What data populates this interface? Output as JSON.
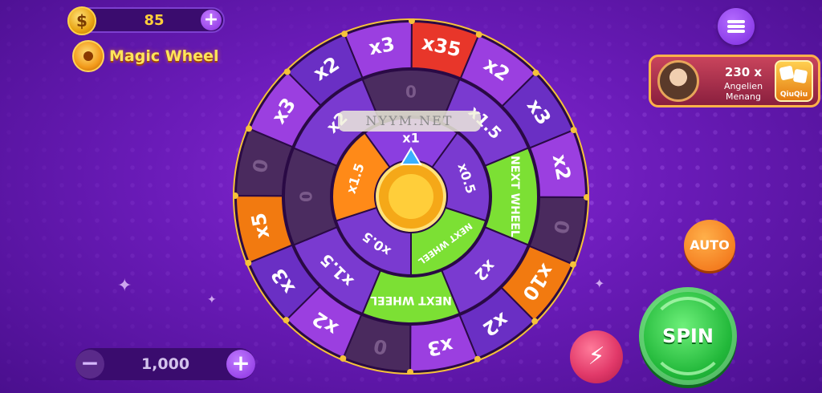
{
  "balance": {
    "amount": "85",
    "coin_symbol": "$",
    "add_label": "+"
  },
  "game": {
    "title": "Magic Wheel"
  },
  "menu": {
    "icon": "hamburger-menu-icon"
  },
  "winner": {
    "multiplier": "230 x",
    "name": "Angelien",
    "action": "Menang",
    "app_logo_text": "QiuQiu"
  },
  "watermark": {
    "plate": "NYYM.NET"
  },
  "wheel": {
    "outer": [
      "x3",
      "x35",
      "x2",
      "x3",
      "x2",
      "0",
      "x10",
      "x2",
      "x3",
      "0",
      "x2",
      "x3",
      "x5",
      "0",
      "x3",
      "x2"
    ],
    "middle": [
      "0",
      "x1.5",
      "NEXT WHEEL",
      "x2",
      "NEXT WHEEL",
      "x1.5",
      "0",
      "x2"
    ],
    "inner": [
      "x1",
      "x0.5",
      "NEXT WHEEL",
      "x0.5",
      "x1.5"
    ],
    "colors": {
      "outer_purple": "#9b3fe0",
      "outer_violet": "#6a2fc4",
      "outer_red": "#e8362a",
      "outer_orange": "#f27a10",
      "outer_dark": "#4a2a5e",
      "middle_pink": "#b537d8",
      "middle_violet": "#7a3ad0",
      "middle_dark": "#4b2c60",
      "inner_purple": "#8b3ee0",
      "inner_green": "#7ce034",
      "inner_orange": "#ff8a18",
      "rim_gold": "#f5c23a"
    }
  },
  "controls": {
    "auto_label": "AUTO",
    "spin_label": "SPIN",
    "turbo_icon": "⚡",
    "bet_value": "1,000",
    "bet_minus": "−",
    "bet_plus": "+"
  }
}
